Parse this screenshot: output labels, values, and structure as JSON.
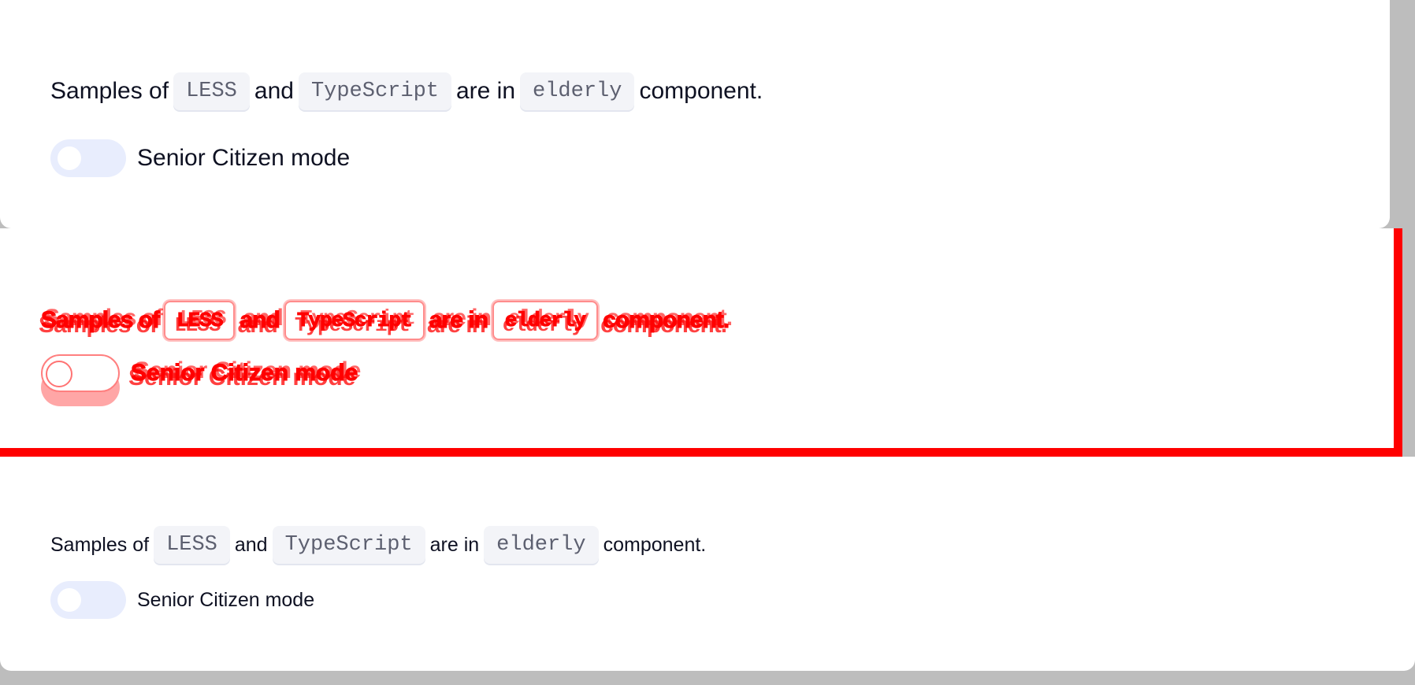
{
  "panels": [
    {
      "variant": "large",
      "sentence": {
        "part1": "Samples of",
        "code1": "LESS",
        "part2": "and",
        "code2": "TypeScript",
        "part3": "are in",
        "code3": "elderly",
        "part4": "component."
      },
      "toggle": {
        "label": "Senior Citizen mode",
        "checked": false
      }
    },
    {
      "variant": "diff",
      "sentence": {
        "part1": "Samples of",
        "code1": "LESS",
        "part2": "and",
        "code2": "TypeScript",
        "part3": "are in",
        "code3": "elderly",
        "part4": "component."
      },
      "toggle": {
        "label": "Senior Citizen mode",
        "checked": false
      }
    },
    {
      "variant": "small",
      "sentence": {
        "part1": "Samples of",
        "code1": "LESS",
        "part2": "and",
        "code2": "TypeScript",
        "part3": "are in",
        "code3": "elderly",
        "part4": "component."
      },
      "toggle": {
        "label": "Senior Citizen mode",
        "checked": false
      }
    }
  ],
  "colors": {
    "background": "#bdbdbd",
    "card": "#ffffff",
    "text": "#0e1122",
    "code_bg": "#f3f4f8",
    "code_text": "#5d6070",
    "switch_track": "#e8edfd",
    "diff_highlight": "#ff0000"
  }
}
